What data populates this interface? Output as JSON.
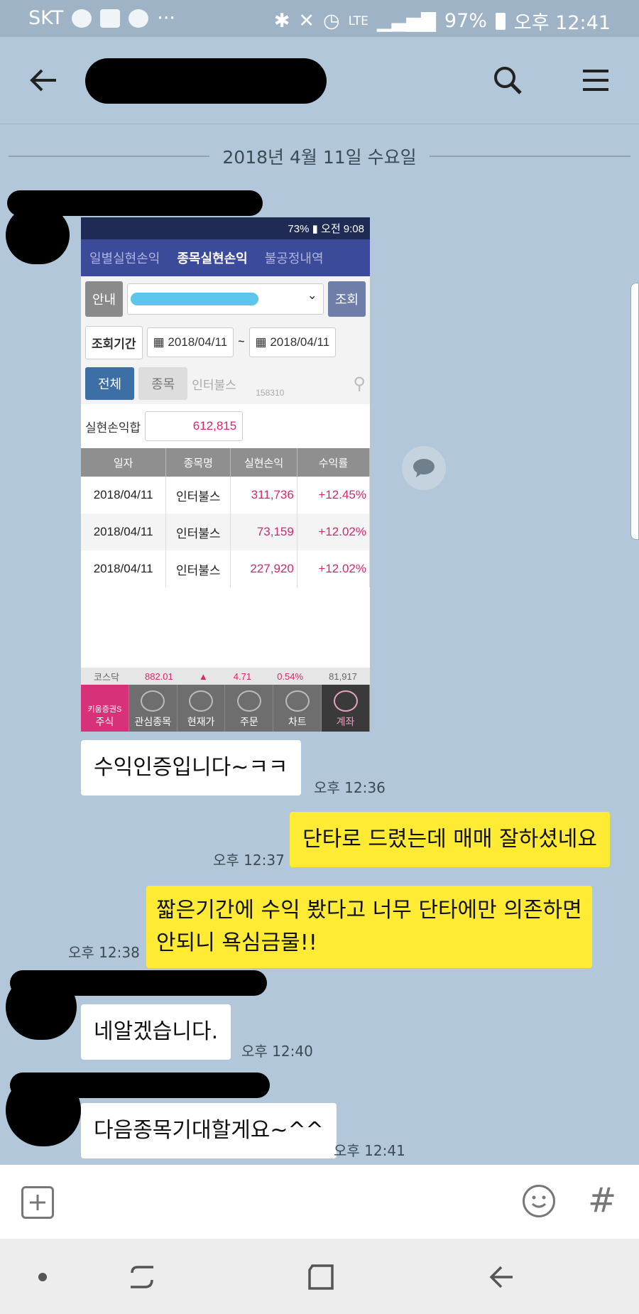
{
  "statusbar": {
    "carrier": "SKT",
    "dots": "···",
    "network": "LTE",
    "battery": "97%",
    "time": "오후 12:41",
    "icons": [
      "talk-icon",
      "message-icon",
      "blog-icon",
      "bluetooth-icon",
      "mute-icon",
      "alarm-icon",
      "signal-icon",
      "battery-icon"
    ]
  },
  "header": {
    "back_icon": "back-arrow-icon",
    "search_icon": "search-icon",
    "menu_icon": "menu-icon"
  },
  "date_separator": "2018년 4월 11일 수요일",
  "screenshot": {
    "status": "73% ▮ 오전 9:08",
    "tabs": [
      "일별실현손익",
      "종목실현손익",
      "불공정내역"
    ],
    "active_tab": "종목실현손익",
    "guide_label": "안내",
    "query_button": "조회",
    "period_label": "조회기간",
    "date_from": "2018/04/11",
    "date_sep": "~",
    "date_to": "2018/04/11",
    "filter_all": "전체",
    "filter_stock": "종목",
    "stock_name": "인터불스",
    "stock_code": "158310",
    "sum_label": "실현손익합",
    "sum_value": "612,815",
    "columns": [
      "일자",
      "종목명",
      "실현손익",
      "수익률"
    ],
    "rows": [
      {
        "date": "2018/04/11",
        "name": "인터불스",
        "profit": "311,736",
        "rate": "+12.45%"
      },
      {
        "date": "2018/04/11",
        "name": "인터불스",
        "profit": "73,159",
        "rate": "+12.02%"
      },
      {
        "date": "2018/04/11",
        "name": "인터불스",
        "profit": "227,920",
        "rate": "+12.02%"
      }
    ],
    "ticker": {
      "market": "코스닥",
      "index": "882.01",
      "arrow": "▲",
      "change": "4.71",
      "pct": "0.54%",
      "volume": "81,917"
    },
    "nav": [
      "주식",
      "관심종목",
      "현재가",
      "주문",
      "차트",
      "계좌"
    ],
    "brand": "키움증권S"
  },
  "messages": [
    {
      "side": "them",
      "text": "수익인증입니다~ㅋㅋ",
      "time": "오후 12:36"
    },
    {
      "side": "me",
      "text": "단타로 드렸는데 매매 잘하셨네요",
      "time": "오후 12:37"
    },
    {
      "side": "me",
      "line1": "짧은기간에 수익 봤다고 너무 단타에만 의존하면",
      "line2": "안되니 욕심금물!!",
      "time": "오후 12:38"
    },
    {
      "side": "them",
      "text": "네알겠습니다.",
      "time": "오후 12:40"
    },
    {
      "side": "them",
      "text": "다음종목기대할게요~^^",
      "time": "오후 12:41"
    }
  ],
  "input_bar": {
    "add_icon": "plus-box-icon",
    "emoji_icon": "emoji-icon",
    "hash_icon": "hash-icon",
    "hash": "#"
  },
  "navbar": {
    "icons": [
      "dot-icon",
      "recents-icon",
      "home-icon",
      "back-icon"
    ]
  },
  "colors": {
    "background": "#b2c7d9",
    "my_bubble": "#ffeb33",
    "their_bubble": "#ffffff",
    "profit": "#d1286f"
  }
}
